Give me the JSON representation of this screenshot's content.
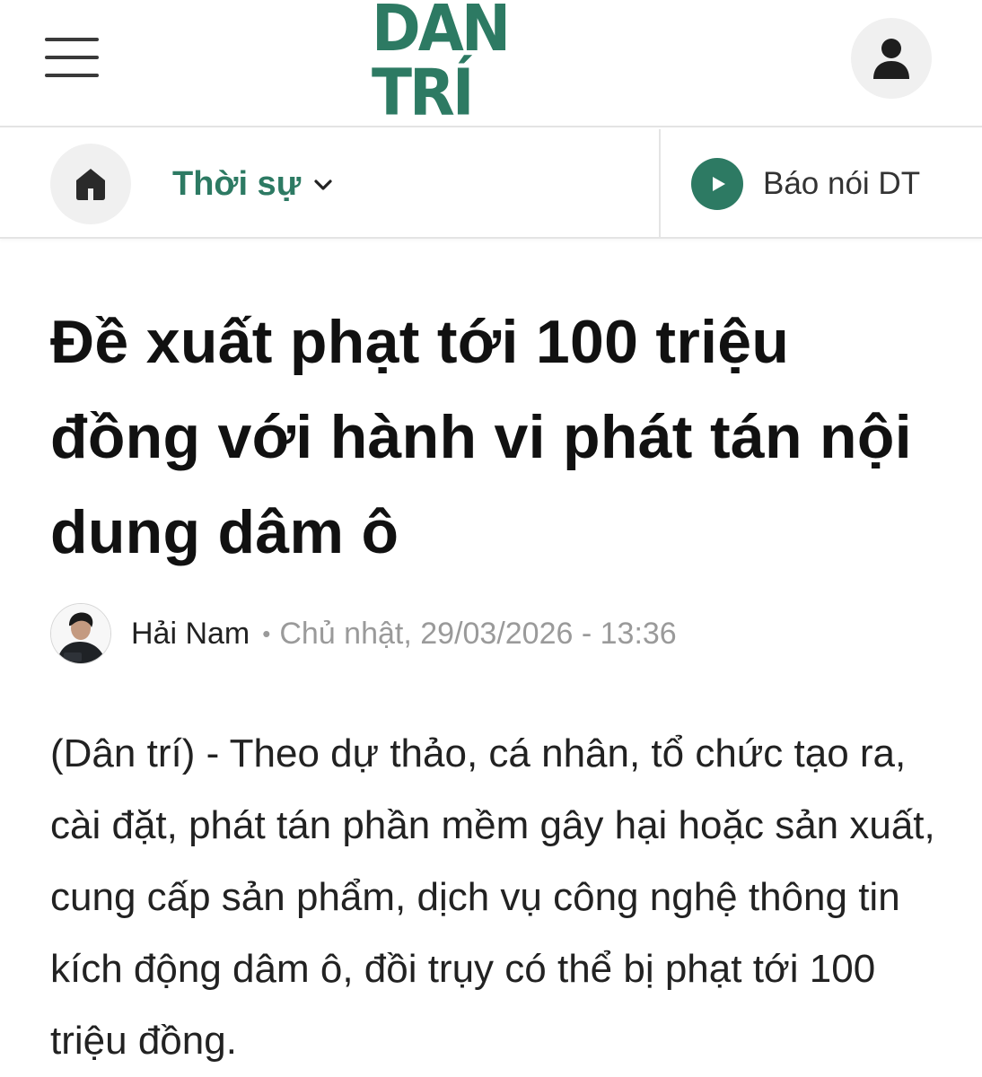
{
  "header": {
    "logo_text": "DÂN TRÍ",
    "menu_icon": "hamburger-menu-icon",
    "account_icon": "user-icon",
    "brand_color": "#2d7a63"
  },
  "subnav": {
    "home_icon": "home-icon",
    "category_label": "Thời sự",
    "category_icon": "chevron-down-icon",
    "audio_label": "Báo nói DT",
    "audio_icon": "play-icon"
  },
  "article": {
    "title": "Đề xuất phạt tới 100 triệu đồng với hành vi phát tán nội dung dâm ô",
    "author": "Hải Nam",
    "separator": "•",
    "published": "Chủ nhật, 29/03/2026 - 13:36",
    "lead": "(Dân trí) - Theo dự thảo, cá nhân, tổ chức tạo ra, cài đặt, phát tán phần mềm gây hại hoặc sản xuất, cung cấp sản phẩm, dịch vụ công nghệ thông tin kích động dâm ô, đồi trụy có thể bị phạt tới 100 triệu đồng."
  }
}
